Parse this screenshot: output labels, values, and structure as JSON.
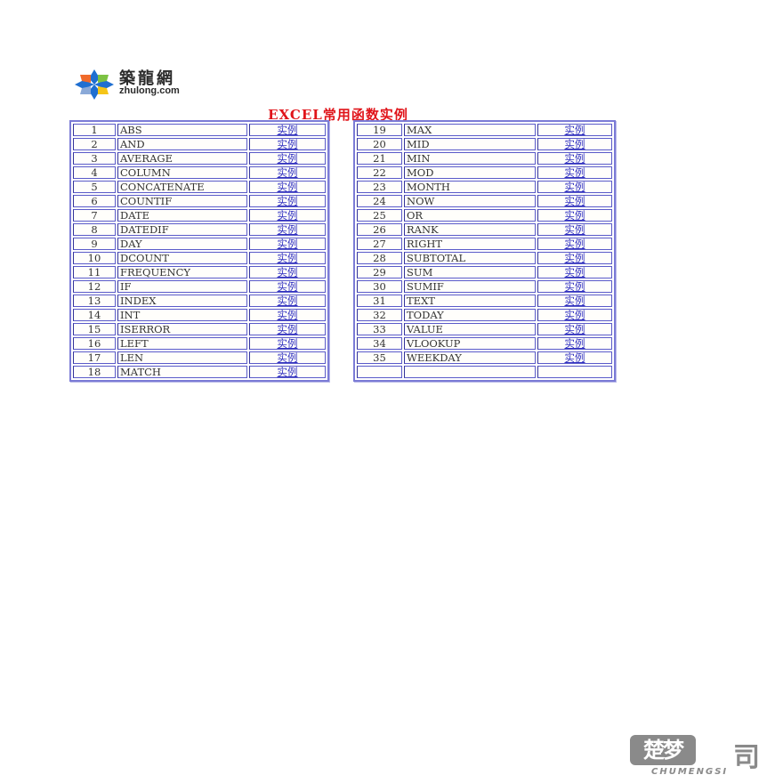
{
  "logo": {
    "cn": "築龍網",
    "en": "zhulong.com",
    "colors": [
      "#1f6fd1",
      "#f06a2a",
      "#7cc243",
      "#f5c518",
      "#8aa9d8"
    ]
  },
  "title": "EXCEL常用函数实例",
  "link_label": "实例",
  "left_table": [
    {
      "num": "1",
      "name": "ABS",
      "link": "实例"
    },
    {
      "num": "2",
      "name": "AND",
      "link": "实例"
    },
    {
      "num": "3",
      "name": "AVERAGE",
      "link": "实例"
    },
    {
      "num": "4",
      "name": "COLUMN",
      "link": "实例"
    },
    {
      "num": "5",
      "name": "CONCATENATE",
      "link": "实例"
    },
    {
      "num": "6",
      "name": "COUNTIF",
      "link": "实例"
    },
    {
      "num": "7",
      "name": "DATE",
      "link": "实例"
    },
    {
      "num": "8",
      "name": "DATEDIF",
      "link": "实例"
    },
    {
      "num": "9",
      "name": "DAY",
      "link": "实例"
    },
    {
      "num": "10",
      "name": "DCOUNT",
      "link": "实例"
    },
    {
      "num": "11",
      "name": "FREQUENCY",
      "link": "实例"
    },
    {
      "num": "12",
      "name": "IF",
      "link": "实例"
    },
    {
      "num": "13",
      "name": "INDEX",
      "link": "实例"
    },
    {
      "num": "14",
      "name": "INT",
      "link": "实例"
    },
    {
      "num": "15",
      "name": "ISERROR",
      "link": "实例"
    },
    {
      "num": "16",
      "name": "LEFT",
      "link": "实例"
    },
    {
      "num": "17",
      "name": "LEN",
      "link": "实例"
    },
    {
      "num": "18",
      "name": "MATCH",
      "link": "实例"
    }
  ],
  "right_table": [
    {
      "num": "19",
      "name": "MAX",
      "link": "实例"
    },
    {
      "num": "20",
      "name": "MID",
      "link": "实例"
    },
    {
      "num": "21",
      "name": "MIN",
      "link": "实例"
    },
    {
      "num": "22",
      "name": "MOD",
      "link": "实例"
    },
    {
      "num": "23",
      "name": "MONTH",
      "link": "实例"
    },
    {
      "num": "24",
      "name": "NOW",
      "link": "实例"
    },
    {
      "num": "25",
      "name": "OR",
      "link": "实例"
    },
    {
      "num": "26",
      "name": "RANK",
      "link": "实例"
    },
    {
      "num": "27",
      "name": "RIGHT",
      "link": "实例"
    },
    {
      "num": "28",
      "name": "SUBTOTAL",
      "link": "实例"
    },
    {
      "num": "29",
      "name": "SUM",
      "link": "实例"
    },
    {
      "num": "30",
      "name": "SUMIF",
      "link": "实例"
    },
    {
      "num": "31",
      "name": "TEXT",
      "link": "实例"
    },
    {
      "num": "32",
      "name": "TODAY",
      "link": "实例"
    },
    {
      "num": "33",
      "name": "VALUE",
      "link": "实例"
    },
    {
      "num": "34",
      "name": "VLOOKUP",
      "link": "实例"
    },
    {
      "num": "35",
      "name": "WEEKDAY",
      "link": "实例"
    },
    {
      "num": "",
      "name": "",
      "link": ""
    }
  ],
  "watermark": {
    "cn_box": "楚梦",
    "cn_side": "司",
    "en": "CHUMENGSI"
  },
  "colors": {
    "title": "#e0141a",
    "link": "#3030c0",
    "table_border": "#5a5ac8"
  }
}
